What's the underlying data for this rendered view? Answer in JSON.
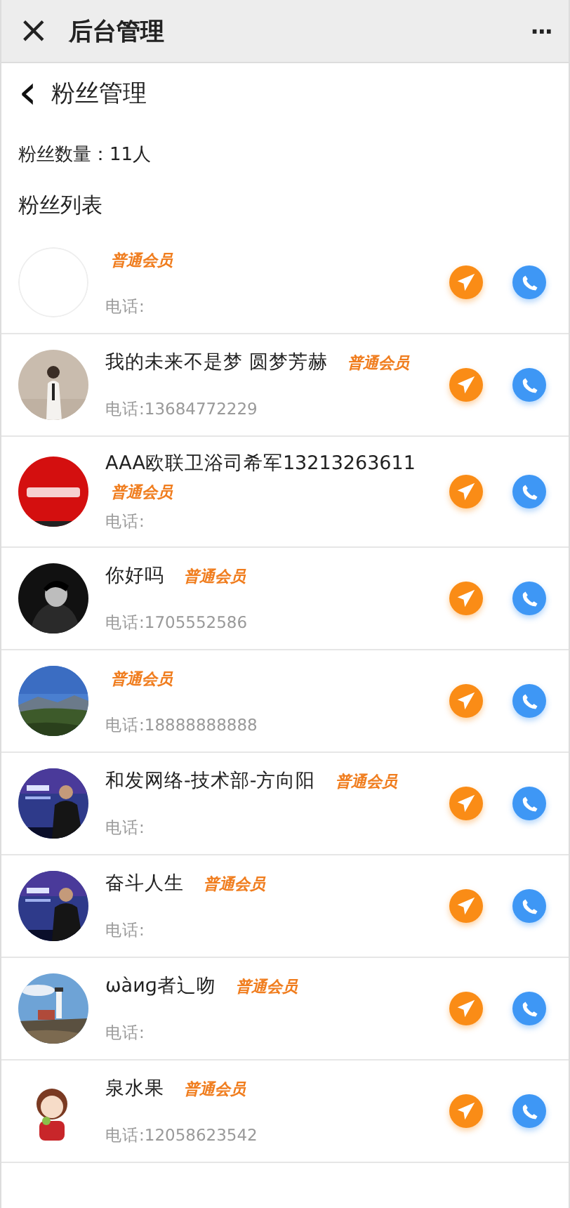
{
  "top_bar": {
    "close": "×",
    "title": "后台管理",
    "more": "···"
  },
  "page": {
    "back": "‹",
    "title": "粉丝管理"
  },
  "fan_count": "粉丝数量：11人",
  "list_title": "粉丝列表",
  "fans": [
    {
      "badge": "普通会员",
      "phone": "电话:"
    },
    {
      "name": "我的未来不是梦 圆梦芳赫",
      "badge": "普通会员",
      "phone": "电话:13684772229"
    },
    {
      "name": "AAA欧联卫浴司希军13213263611",
      "badge": "普通会员",
      "phone": "电话:"
    },
    {
      "name": "你好吗",
      "badge": "普通会员",
      "phone": "电话:1705552586"
    },
    {
      "badge": "普通会员",
      "phone": "电话:18888888888"
    },
    {
      "name": "和发网络-技术部-方向阳",
      "badge": "普通会员",
      "phone": "电话:"
    },
    {
      "name": "奋斗人生",
      "badge": "普通会员",
      "phone": "电话:"
    },
    {
      "name": "ωàиɡ者辶吻",
      "badge": "普通会员",
      "phone": "电话:"
    },
    {
      "name": "泉水果",
      "badge": "普通会员",
      "phone": "电话:12058623542"
    }
  ]
}
